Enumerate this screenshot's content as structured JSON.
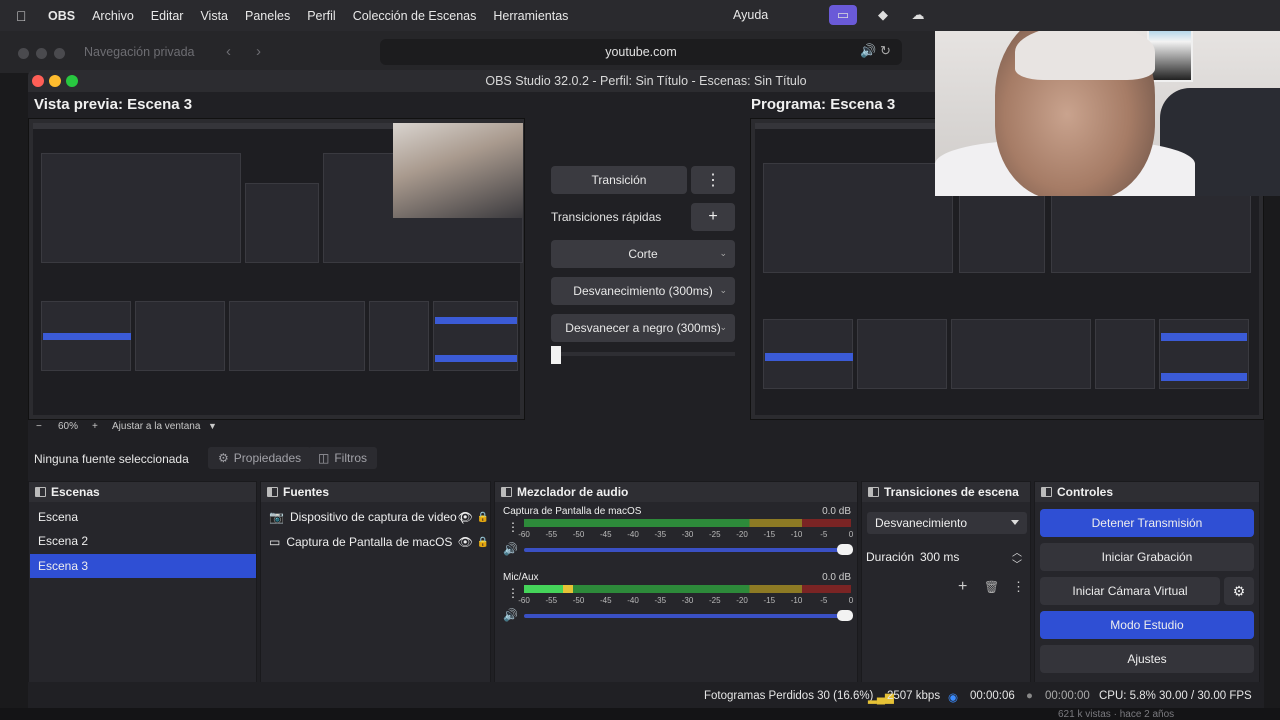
{
  "menubar": {
    "app": "OBS",
    "items": [
      "Archivo",
      "Editar",
      "Vista",
      "Paneles",
      "Perfil",
      "Colección de Escenas",
      "Herramientas"
    ],
    "help": "Ayuda"
  },
  "browser": {
    "private_label": "Navegación privada",
    "url": "youtube.com"
  },
  "window": {
    "title": "OBS Studio 32.0.2 - Perfil: Sin Título - Escenas: Sin Título"
  },
  "preview": {
    "label": "Vista previa: Escena 3",
    "zoom": "60%",
    "fit": "Ajustar a la ventana"
  },
  "program": {
    "label": "Programa: Escena 3"
  },
  "transitions_panel": {
    "transition_button": "Transición",
    "quick_label": "Transiciones rápidas",
    "quick_items": [
      "Corte",
      "Desvanecimiento (300ms)",
      "Desvanecer a negro (300ms)"
    ]
  },
  "source_toolbar": {
    "none_selected": "Ninguna fuente seleccionada",
    "properties": "Propiedades",
    "filters": "Filtros"
  },
  "scenes": {
    "title": "Escenas",
    "items": [
      "Escena",
      "Escena 2",
      "Escena 3"
    ],
    "selected_index": 2
  },
  "sources": {
    "title": "Fuentes",
    "items": [
      "Dispositivo de captura de video (",
      "Captura de Pantalla de macOS"
    ]
  },
  "mixer": {
    "title": "Mezclador de audio",
    "channels": [
      {
        "name": "Captura de Pantalla de macOS",
        "db": "0.0 dB",
        "level": 0
      },
      {
        "name": "Mic/Aux",
        "db": "0.0 dB",
        "level": 0.15
      }
    ],
    "ticks": [
      "-60",
      "-55",
      "-50",
      "-45",
      "-40",
      "-35",
      "-30",
      "-25",
      "-20",
      "-15",
      "-10",
      "-5",
      "0"
    ]
  },
  "scene_transitions": {
    "title": "Transiciones de escena",
    "selected": "Desvanecimiento",
    "duration_label": "Duración",
    "duration_value": "300 ms"
  },
  "controls": {
    "title": "Controles",
    "stop_stream": "Detener Transmisión",
    "start_recording": "Iniciar Grabación",
    "start_virtual_cam": "Iniciar Cámara Virtual",
    "studio_mode": "Modo Estudio",
    "settings": "Ajustes"
  },
  "status": {
    "dropped": "Fotogramas Perdidos 30 (16.6%)",
    "bitrate": "2507 kbps",
    "stream_time": "00:00:06",
    "rec_time": "00:00:00",
    "cpu": "CPU: 5.8%",
    "fps": "30.00 / 30.00 FPS"
  },
  "footer": {
    "views": "621 k vistas · hace 2 años"
  },
  "colors": {
    "accent": "#2f4fd4",
    "meter_green": "#45d45a",
    "meter_yellow": "#e6c236",
    "meter_red": "#7a2424"
  }
}
